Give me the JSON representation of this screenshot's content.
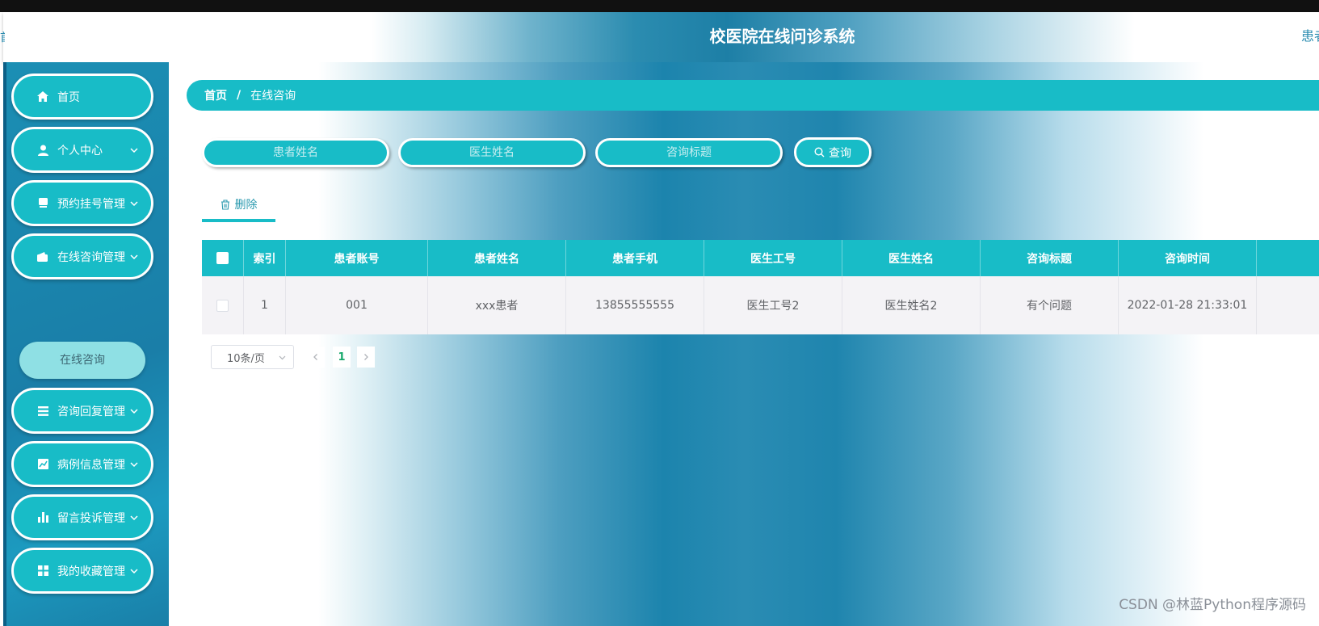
{
  "app": {
    "title": "校医院在线问诊系统",
    "user_label": "患者",
    "left_edge_char": "首"
  },
  "sidebar": {
    "items": [
      {
        "label": "首页",
        "icon": "home-icon",
        "expandable": false
      },
      {
        "label": "个人中心",
        "icon": "user-icon",
        "expandable": true
      },
      {
        "label": "预约挂号管理",
        "icon": "ticket-icon",
        "expandable": true
      },
      {
        "label": "在线咨询管理",
        "icon": "wallet-icon",
        "expandable": true
      },
      {
        "label": "咨询回复管理",
        "icon": "list-icon",
        "expandable": true
      },
      {
        "label": "病例信息管理",
        "icon": "chart-line-icon",
        "expandable": true
      },
      {
        "label": "留言投诉管理",
        "icon": "bar-chart-icon",
        "expandable": true
      },
      {
        "label": "我的收藏管理",
        "icon": "grid-icon",
        "expandable": true
      }
    ],
    "sub_item": "在线咨询"
  },
  "breadcrumb": {
    "home": "首页",
    "separator": "/",
    "current": "在线咨询"
  },
  "search": {
    "patient_name_placeholder": "患者姓名",
    "doctor_name_placeholder": "医生姓名",
    "title_placeholder": "咨询标题",
    "button_label": "查询"
  },
  "actions": {
    "delete_label": "删除"
  },
  "table": {
    "columns": [
      "索引",
      "患者账号",
      "患者姓名",
      "患者手机",
      "医生工号",
      "医生姓名",
      "咨询标题",
      "咨询时间"
    ],
    "rows": [
      [
        "1",
        "001",
        "xxx患者",
        "13855555555",
        "医生工号2",
        "医生姓名2",
        "有个问题",
        "2022-01-28 21:33:01"
      ]
    ]
  },
  "pagination": {
    "page_size": "10条/页",
    "current_page": "1"
  },
  "watermark": "CSDN @林蓝Python程序源码",
  "colors": {
    "accent": "#18bcc7",
    "sidebar": "#1a7ea8",
    "active_page": "#18a86b"
  }
}
